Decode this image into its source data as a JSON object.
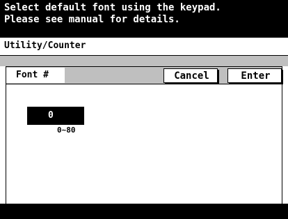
{
  "header": {
    "line1": "Select default font using the keypad.",
    "line2": "Please see manual for details."
  },
  "breadcrumb": {
    "text": "Utility/Counter"
  },
  "panel": {
    "title": "Font #",
    "cancel_label": "Cancel",
    "enter_label": "Enter",
    "value": "0",
    "range": "0~80"
  },
  "colors": {
    "background": "#ffffff",
    "foreground": "#000000"
  }
}
